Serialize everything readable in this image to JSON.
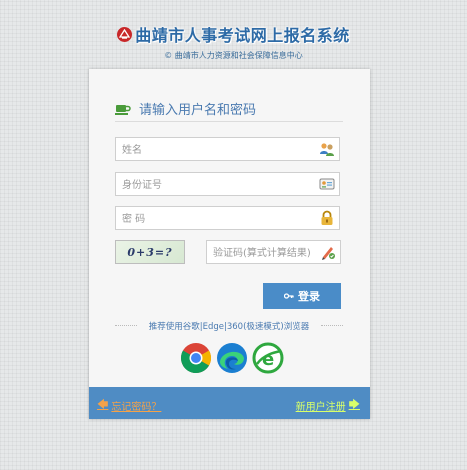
{
  "header": {
    "title": "曲靖市人事考试网上报名系统",
    "subtitle": "© 曲靖市人力资源和社会保障信息中心"
  },
  "form": {
    "heading": "请输入用户名和密码",
    "name_placeholder": "姓名",
    "id_placeholder": "身份证号",
    "password_placeholder": "密 码",
    "captcha_text": "0+3=?",
    "captcha_placeholder": "验证码(算式计算结果)",
    "login_label": "登录",
    "recommend_text": "推荐使用谷歌|Edge|360(极速模式)浏览器"
  },
  "browsers": [
    "chrome-icon",
    "edge-icon",
    "360-browser-icon"
  ],
  "footer": {
    "forgot_label": "忘记密码？",
    "register_label": "新用户注册"
  },
  "colors": {
    "accent": "#4a8cc8",
    "footer_bg": "#4f8cc4",
    "forgot_link": "#f3a24a",
    "register_link": "#d8ff6a",
    "logo_red": "#c8282a"
  }
}
